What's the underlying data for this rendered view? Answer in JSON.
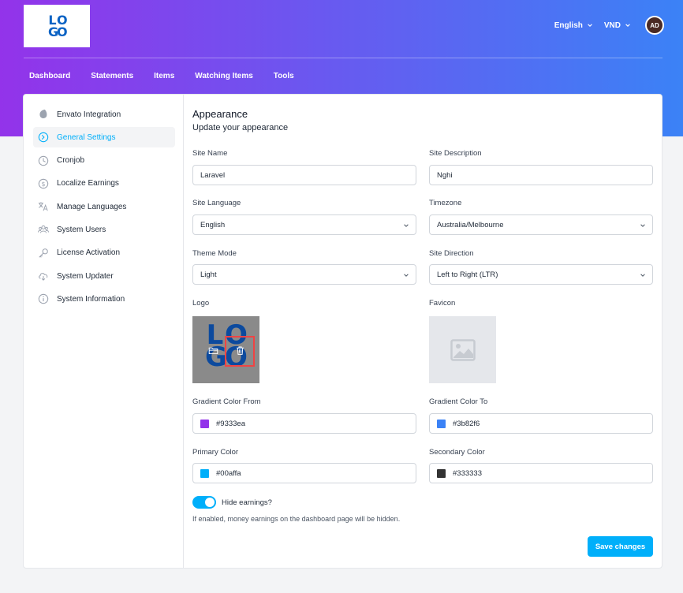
{
  "header": {
    "logo_letters": [
      "L",
      "O",
      "G",
      "O"
    ],
    "language": "English",
    "currency": "VND",
    "avatar_initials": "AD"
  },
  "nav": [
    "Dashboard",
    "Statements",
    "Items",
    "Watching Items",
    "Tools"
  ],
  "sidebar": {
    "items": [
      {
        "label": "Envato Integration",
        "icon": "envato-leaf-icon",
        "active": false
      },
      {
        "label": "General Settings",
        "icon": "settings-icon",
        "active": true
      },
      {
        "label": "Cronjob",
        "icon": "clock-icon",
        "active": false
      },
      {
        "label": "Localize Earnings",
        "icon": "dollar-icon",
        "active": false
      },
      {
        "label": "Manage Languages",
        "icon": "translate-icon",
        "active": false
      },
      {
        "label": "System Users",
        "icon": "users-icon",
        "active": false
      },
      {
        "label": "License Activation",
        "icon": "key-icon",
        "active": false
      },
      {
        "label": "System Updater",
        "icon": "cloud-download-icon",
        "active": false
      },
      {
        "label": "System Information",
        "icon": "info-icon",
        "active": false
      }
    ]
  },
  "form": {
    "title": "Appearance",
    "subtitle": "Update your appearance",
    "site_name": {
      "label": "Site Name",
      "value": "Laravel"
    },
    "site_description": {
      "label": "Site Description",
      "value": "Nghi"
    },
    "site_language": {
      "label": "Site Language",
      "value": "English"
    },
    "timezone": {
      "label": "Timezone",
      "value": "Australia/Melbourne"
    },
    "theme_mode": {
      "label": "Theme Mode",
      "value": "Light"
    },
    "site_direction": {
      "label": "Site Direction",
      "value": "Left to Right (LTR)"
    },
    "logo_label": "Logo",
    "favicon_label": "Favicon",
    "gradient_from": {
      "label": "Gradient Color From",
      "value": "#9333ea"
    },
    "gradient_to": {
      "label": "Gradient Color To",
      "value": "#3b82f6"
    },
    "primary_color": {
      "label": "Primary Color",
      "value": "#00affa"
    },
    "secondary_color": {
      "label": "Secondary Color",
      "value": "#333333"
    },
    "hide_earnings": {
      "label": "Hide earnings?",
      "help": "If enabled, money earnings on the dashboard page will be hidden.",
      "enabled": true
    },
    "save_label": "Save changes"
  }
}
